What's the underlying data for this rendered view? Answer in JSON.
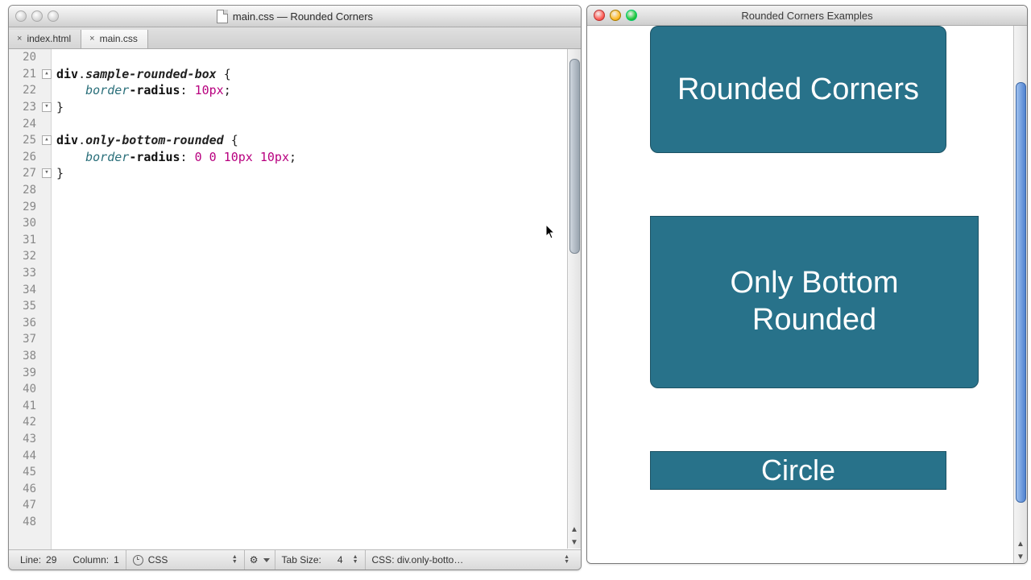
{
  "editor": {
    "window_title": "main.css — Rounded Corners",
    "tabs": [
      {
        "label": "index.html",
        "active": false
      },
      {
        "label": "main.css",
        "active": true
      }
    ],
    "first_line_number": 20,
    "last_line_number": 48,
    "fold_markers": {
      "21": "down",
      "23": "up",
      "25": "down",
      "27": "up"
    },
    "code_lines": {
      "l20": "",
      "l21_tag": "div",
      "l21_dot": ".",
      "l21_class": "sample-rounded-box",
      "l21_brace": " {",
      "l22_indent": "    ",
      "l22_prop1": "border",
      "l22_dash": "-",
      "l22_prop2": "radius",
      "l22_colon": ": ",
      "l22_val": "10px",
      "l22_semi": ";",
      "l23_brace": "}",
      "l24": "",
      "l25_tag": "div",
      "l25_dot": ".",
      "l25_class": "only-bottom-rounded",
      "l25_brace": " {",
      "l26_indent": "    ",
      "l26_prop1": "border",
      "l26_dash": "-",
      "l26_prop2": "radius",
      "l26_colon": ": ",
      "l26_v1": "0",
      "l26_sp1": " ",
      "l26_v2": "0",
      "l26_sp2": " ",
      "l26_v3": "10px",
      "l26_sp3": " ",
      "l26_v4": "10px",
      "l26_semi": ";",
      "l27_brace": "}"
    },
    "status": {
      "line_label": "Line:",
      "line": "29",
      "col_label": "Column:",
      "col": "1",
      "lang": "CSS",
      "tab_label": "Tab Size:",
      "tab": "4",
      "scope": "CSS: div.only-botto…"
    }
  },
  "browser": {
    "window_title": "Rounded Corners Examples",
    "boxes": {
      "rounded": "Rounded Corners",
      "bottom": "Only Bottom Rounded",
      "circle": "Circle"
    }
  }
}
